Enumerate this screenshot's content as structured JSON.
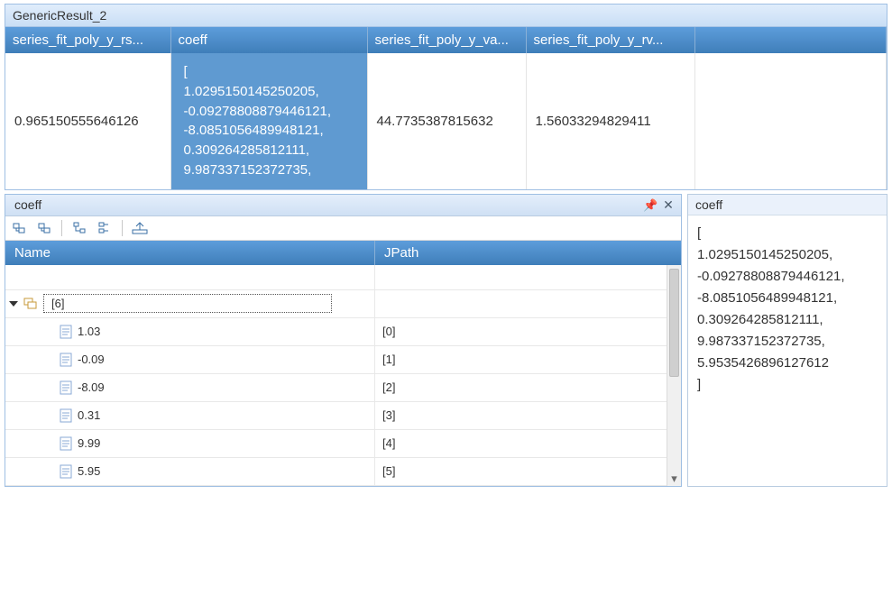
{
  "top": {
    "title": "GenericResult_2",
    "columns": [
      "series_fit_poly_y_rs...",
      "coeff",
      "series_fit_poly_y_va...",
      "series_fit_poly_y_rv..."
    ],
    "row": {
      "rs": "0.965150555646126",
      "coeff_lines": [
        "[",
        "  1.0295150145250205,",
        "  -0.09278808879446121,",
        "  -8.0851056489948121,",
        "  0.309264285812111,",
        "  9.987337152372735,"
      ],
      "va": "44.7735387815632",
      "rv": "1.56033294829411"
    }
  },
  "tree": {
    "title": "coeff",
    "headers": {
      "name": "Name",
      "jpath": "JPath"
    },
    "root_label": "[6]",
    "items": [
      {
        "value": "1.03",
        "jpath": "[0]"
      },
      {
        "value": "-0.09",
        "jpath": "[1]"
      },
      {
        "value": "-8.09",
        "jpath": "[2]"
      },
      {
        "value": "0.31",
        "jpath": "[3]"
      },
      {
        "value": "9.99",
        "jpath": "[4]"
      },
      {
        "value": "5.95",
        "jpath": "[5]"
      }
    ]
  },
  "detail": {
    "title": "coeff",
    "lines": [
      "[",
      "  1.0295150145250205,",
      "  -0.09278808879446121,",
      "  -8.0851056489948121,",
      "  0.309264285812111,",
      "  9.987337152372735,",
      "  5.9535426896127612",
      "]"
    ]
  }
}
